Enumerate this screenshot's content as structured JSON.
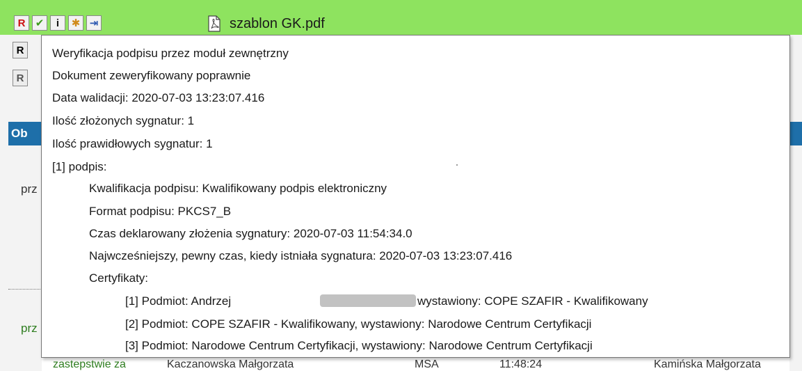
{
  "toolbar": {
    "buttons": [
      {
        "icon": "remove-signature-icon",
        "glyph": "R",
        "color": "#cc1111"
      },
      {
        "icon": "verify-check-icon",
        "glyph": "✔",
        "color": "#3c9a1c"
      },
      {
        "icon": "info-icon",
        "glyph": "i",
        "color": "#111111"
      },
      {
        "icon": "document-star-icon",
        "glyph": "✱",
        "color": "#d08a1a"
      },
      {
        "icon": "export-document-icon",
        "glyph": "⇥",
        "color": "#2a56b0"
      }
    ],
    "file_name": "szablon GK.pdf"
  },
  "side": {
    "btn1_glyph": "R",
    "btn2_glyph": "R",
    "header_label": "Ob",
    "text1": "prz",
    "text2": "prz"
  },
  "tooltip": {
    "line1": "Weryfikacja podpisu przez moduł zewnętrzny",
    "line2": "Dokument zeweryfikowany poprawnie",
    "line3": "Data walidacji: 2020-07-03 13:23:07.416",
    "line4": "Ilość złożonych sygnatur: 1",
    "line5": "Ilość prawidłowych sygnatur: 1",
    "line6": "[1] podpis:",
    "line7": "Kwalifikacja podpisu: Kwalifikowany podpis elektroniczny",
    "line8": "Format podpisu: PKCS7_B",
    "line9": "Czas deklarowany złożenia sygnatury: 2020-07-03 11:54:34.0",
    "line10": "Najwcześniejszy, pewny czas, kiedy istniała sygnatura: 2020-07-03 13:23:07.416",
    "line11": "Certyfikaty:",
    "cert1_prefix": "[1] Podmiot: Andrzej",
    "cert1_suffix": "wystawiony: COPE SZAFIR - Kwalifikowany",
    "cert2": "[2] Podmiot: COPE SZAFIR - Kwalifikowany, wystawiony: Narodowe Centrum Certyfikacji",
    "cert3": "[3] Podmiot: Narodowe Centrum Certyfikacji, wystawiony: Narodowe Centrum Certyfikacji"
  },
  "bottom": {
    "c1": "zastepstwie za",
    "c2": "Kaczanowska Małgorzata",
    "c3": "MSA",
    "c4": "11:48:24",
    "c5": "Kamińska Małgorzata"
  }
}
